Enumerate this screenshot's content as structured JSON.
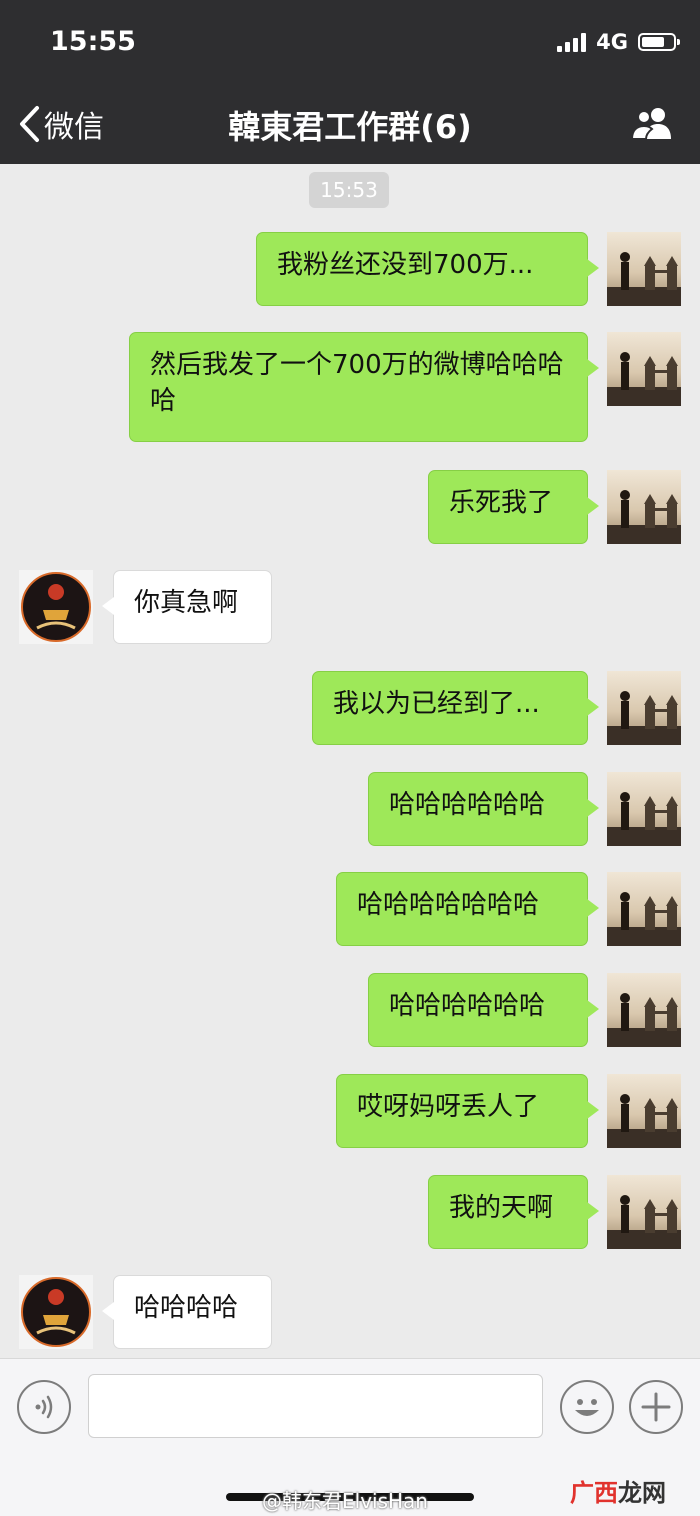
{
  "status_bar": {
    "time": "15:55",
    "network": "4G"
  },
  "nav": {
    "back_label": "微信",
    "title": "韓東君工作群(6)"
  },
  "chat": {
    "timestamp": "15:53",
    "messages": [
      {
        "side": "out",
        "text": "我粉丝还没到700万..."
      },
      {
        "side": "out",
        "text": "然后我发了一个700万的微博哈哈哈哈"
      },
      {
        "side": "out",
        "text": "乐死我了"
      },
      {
        "side": "in",
        "text": "你真急啊"
      },
      {
        "side": "out",
        "text": "我以为已经到了..."
      },
      {
        "side": "out",
        "text": "哈哈哈哈哈哈"
      },
      {
        "side": "out",
        "text": "哈哈哈哈哈哈哈"
      },
      {
        "side": "out",
        "text": "哈哈哈哈哈哈"
      },
      {
        "side": "out",
        "text": "哎呀妈呀丢人了"
      },
      {
        "side": "out",
        "text": "我的天啊"
      },
      {
        "side": "in",
        "text": "哈哈哈哈"
      }
    ]
  },
  "input_bar": {
    "watermark": "@韩东君ElvisHan",
    "site_logo_red": "广西",
    "site_logo_dark": "龙网"
  },
  "colors": {
    "header_bg": "#2e2e30",
    "outgoing_bubble": "#9ee859",
    "incoming_bubble": "#ffffff",
    "chat_bg": "#ebebeb"
  }
}
